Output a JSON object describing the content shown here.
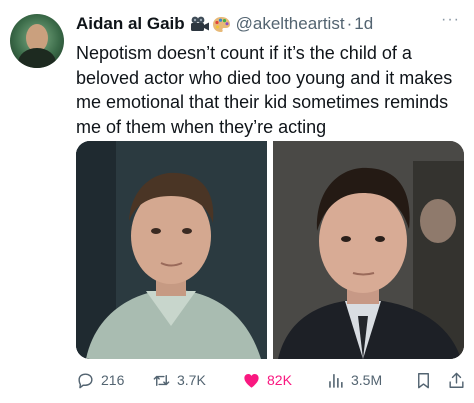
{
  "tweet": {
    "author_name": "Aidan al Gaib",
    "handle": "@akeltheartist",
    "separator": "·",
    "time": "1d",
    "more": "···",
    "text": "Nepotism doesn’t count if it’s the child of a beloved actor who died too young and it makes me emotional that their kid sometimes reminds me of them when they’re acting",
    "emojis": [
      "movie-camera-icon",
      "artist-palette-icon"
    ]
  },
  "actions": {
    "replies": "216",
    "retweets": "3.7K",
    "likes": "82K",
    "views": "3.5M"
  },
  "colors": {
    "like": "#f91880",
    "muted": "#536471",
    "text": "#0f1419"
  }
}
